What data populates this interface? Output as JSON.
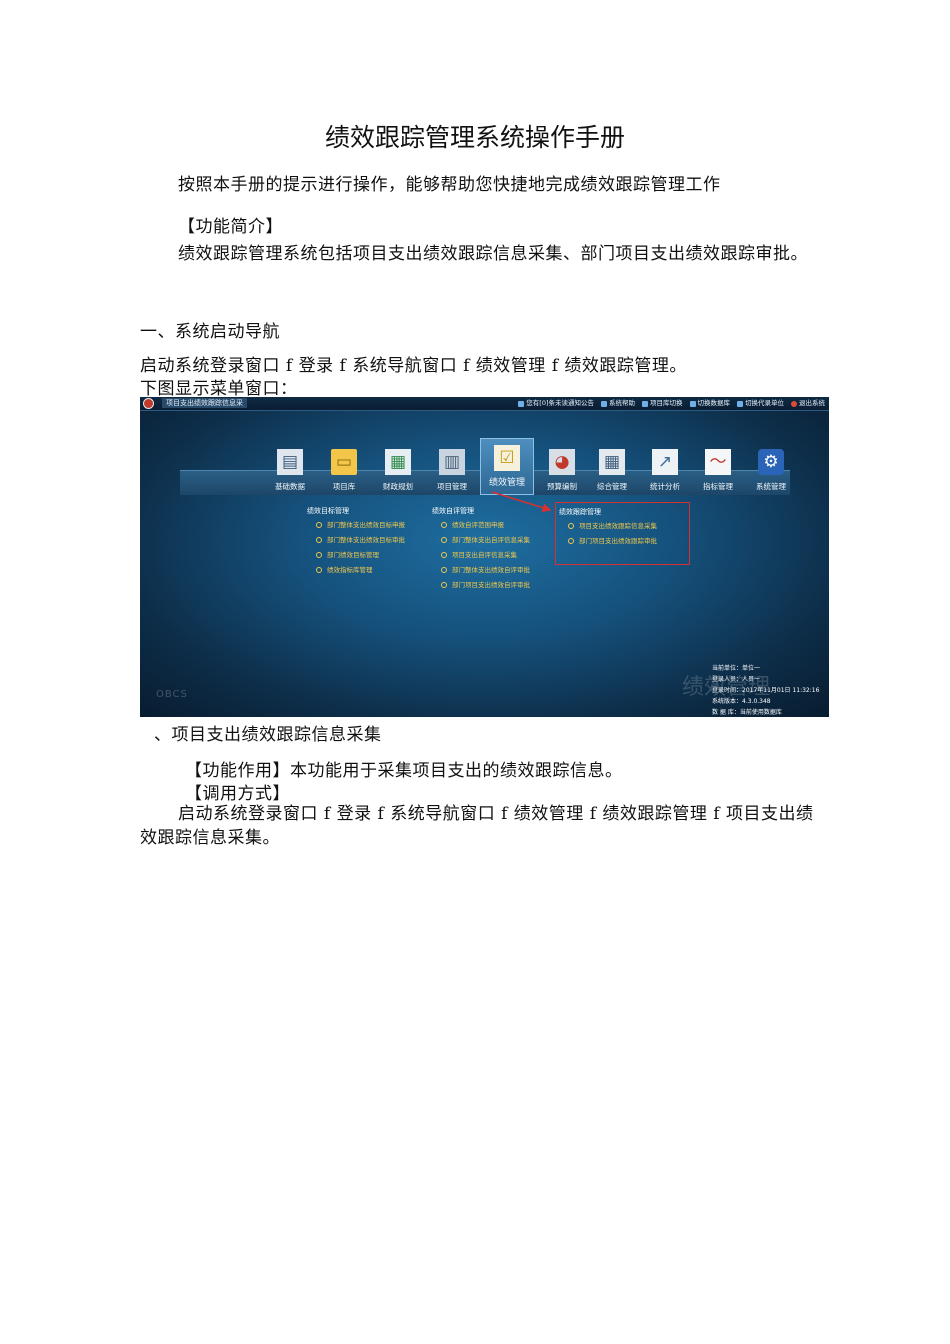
{
  "title": "绩效跟踪管理系统操作手册",
  "intro": "按照本手册的提示进行操作，能够帮助您快捷地完成绩效跟踪管理工作",
  "func_heading": "【功能简介】",
  "func_text": "绩效跟踪管理系统包括项目支出绩效跟踪信息采集、部门项目支出绩效跟踪审批。",
  "section1_heading": "一、系统启动导航",
  "section1_path": "启动系统登录窗口 f 登录 f 系统导航窗口 f 绩效管理 f 绩效跟踪管理。",
  "section1_caption": "下图显示菜单窗口：",
  "screenshot": {
    "sys_title": "项目支出绩效跟踪信息采",
    "top_links": [
      "您有[0]条未读通知公告",
      "系统帮助",
      "项目库切换",
      "切换数据库",
      "切换代录单位",
      "退出系统"
    ],
    "modules": [
      {
        "label": "基础数据",
        "icon": "document-icon"
      },
      {
        "label": "项目库",
        "icon": "folder-icon"
      },
      {
        "label": "财政规划",
        "icon": "plan-icon"
      },
      {
        "label": "项目管理",
        "icon": "building-icon"
      },
      {
        "label": "绩效管理",
        "icon": "checklist-icon"
      },
      {
        "label": "预算编制",
        "icon": "budget-icon"
      },
      {
        "label": "综合管理",
        "icon": "table-icon"
      },
      {
        "label": "统计分析",
        "icon": "chart-icon"
      },
      {
        "label": "指标管理",
        "icon": "monitor-icon"
      },
      {
        "label": "系统管理",
        "icon": "gear-icon"
      }
    ],
    "menu_columns": [
      {
        "heading": "绩效目标管理",
        "items": [
          "部门整体支出绩效目标申报",
          "部门整体支出绩效目标审批",
          "部门绩效目标管理",
          "绩效指标库管理"
        ]
      },
      {
        "heading": "绩效自评管理",
        "items": [
          "绩效自评范围申报",
          "部门整体支出自评信息采集",
          "项目支出自评信息采集",
          "部门整体支出绩效自评审批",
          "部门项目支出绩效自评审批"
        ]
      },
      {
        "heading": "绩效跟踪管理",
        "items": [
          "项目支出绩效跟踪信息采集",
          "部门项目支出绩效跟踪审批"
        ]
      }
    ],
    "status": [
      "当前单位：单位一",
      "登录人员：人员一",
      "登录时间：2017年11月01日 11:32:16",
      "系统版本：4.3.0.348",
      "数 据 库：当前使用数据库"
    ],
    "watermark": "绩效管理",
    "brand": "OBCS",
    "accent": "#d83030"
  },
  "section2_heading": "、项目支出绩效跟踪信息采集",
  "role_text": "【功能作用】本功能用于采集项目支出的绩效跟踪信息。",
  "call_heading": "【调用方式】",
  "call_text": "启动系统登录窗口 f 登录 f 系统导航窗口 f 绩效管理 f 绩效跟踪管理 f 项目支出绩效跟踪信息采集。"
}
